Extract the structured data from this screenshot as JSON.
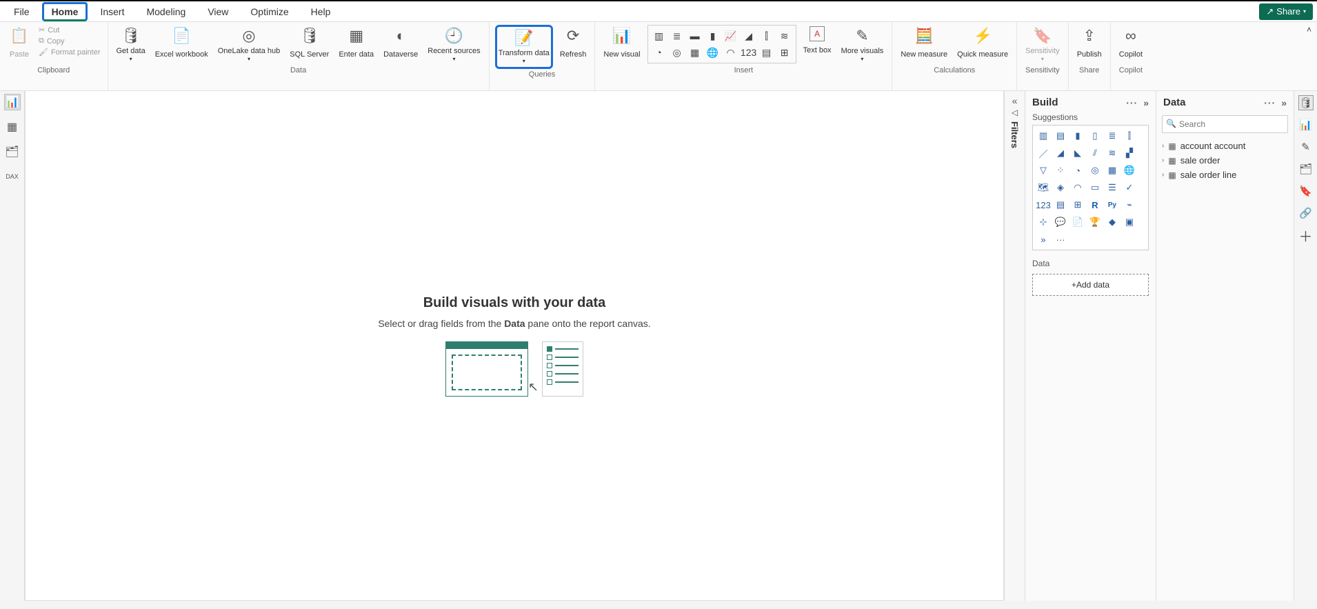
{
  "menubar": {
    "tabs": [
      "File",
      "Home",
      "Insert",
      "Modeling",
      "View",
      "Optimize",
      "Help"
    ],
    "share": "Share"
  },
  "ribbon": {
    "clipboard": {
      "paste": "Paste",
      "cut": "Cut",
      "copy": "Copy",
      "format_painter": "Format painter",
      "group": "Clipboard"
    },
    "data": {
      "get_data": "Get data",
      "excel": "Excel workbook",
      "onelake": "OneLake data hub",
      "sql": "SQL Server",
      "enter": "Enter data",
      "dataverse": "Dataverse",
      "recent": "Recent sources",
      "group": "Data"
    },
    "queries": {
      "transform": "Transform data",
      "refresh": "Refresh",
      "group": "Queries"
    },
    "insert": {
      "new_visual": "New visual",
      "text_box": "Text box",
      "more_visuals": "More visuals",
      "group": "Insert"
    },
    "calc": {
      "new_measure": "New measure",
      "quick_measure": "Quick measure",
      "group": "Calculations"
    },
    "sensitivity": {
      "label": "Sensitivity",
      "group": "Sensitivity"
    },
    "share": {
      "publish": "Publish",
      "group": "Share"
    },
    "copilot": {
      "label": "Copilot",
      "group": "Copilot"
    }
  },
  "leftrail": {
    "tooltip": "Report view"
  },
  "canvas": {
    "title": "Build visuals with your data",
    "text_a": "Select or drag fields from the ",
    "text_b": "Data",
    "text_c": " pane onto the report canvas."
  },
  "filters": {
    "label": "Filters"
  },
  "build": {
    "title": "Build",
    "sub": "Suggestions",
    "data_label": "Data",
    "add_data": "+Add data"
  },
  "data": {
    "title": "Data",
    "search": "Search",
    "tables": [
      "account account",
      "sale order",
      "sale order line"
    ]
  }
}
